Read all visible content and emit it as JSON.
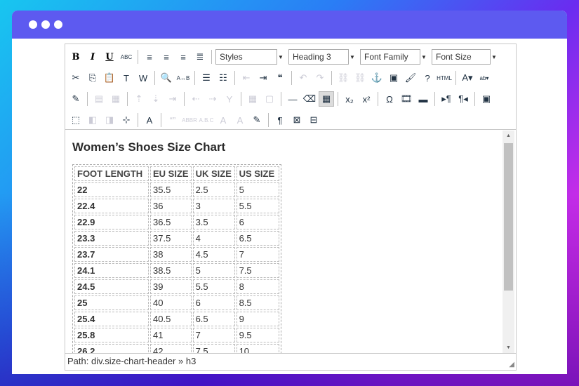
{
  "toolbar": {
    "rows": [
      [
        {
          "name": "bold",
          "glyph": "B"
        },
        {
          "name": "italic",
          "glyph": "I"
        },
        {
          "name": "underline",
          "glyph": "U"
        },
        {
          "name": "strikethrough",
          "glyph": "ABC"
        },
        {
          "sep": true
        },
        {
          "name": "align-left",
          "glyph": "≡"
        },
        {
          "name": "align-center",
          "glyph": "≡"
        },
        {
          "name": "align-right",
          "glyph": "≡"
        },
        {
          "name": "align-justify",
          "glyph": "≣"
        },
        {
          "sep": true
        },
        {
          "select": "styles",
          "label": "Styles",
          "w": 88
        },
        {
          "select": "format",
          "label": "Heading 3",
          "w": 86
        },
        {
          "select": "font-family",
          "label": "Font Family",
          "w": 86
        },
        {
          "select": "font-size",
          "label": "Font Size",
          "w": 84
        }
      ],
      [
        {
          "name": "cut",
          "glyph": "✂"
        },
        {
          "name": "copy",
          "glyph": "⎘"
        },
        {
          "name": "paste",
          "glyph": "📋"
        },
        {
          "name": "paste-text",
          "glyph": "T"
        },
        {
          "name": "paste-word",
          "glyph": "W"
        },
        {
          "sep": true
        },
        {
          "name": "find",
          "glyph": "🔍"
        },
        {
          "name": "replace",
          "glyph": "A↔B"
        },
        {
          "sep": true
        },
        {
          "name": "bullet-list",
          "glyph": "☰"
        },
        {
          "name": "numbered-list",
          "glyph": "☷"
        },
        {
          "sep": true
        },
        {
          "name": "outdent",
          "glyph": "⇤",
          "dis": true
        },
        {
          "name": "indent",
          "glyph": "⇥"
        },
        {
          "name": "blockquote",
          "glyph": "❝"
        },
        {
          "sep": true
        },
        {
          "name": "undo",
          "glyph": "↶",
          "dis": true
        },
        {
          "name": "redo",
          "glyph": "↷",
          "dis": true
        },
        {
          "sep": true
        },
        {
          "name": "link",
          "glyph": "⛓",
          "dis": true
        },
        {
          "name": "unlink",
          "glyph": "⛓",
          "dis": true
        },
        {
          "name": "anchor",
          "glyph": "⚓"
        },
        {
          "name": "image",
          "glyph": "▣"
        },
        {
          "name": "cleanup",
          "glyph": "🖌"
        },
        {
          "name": "help",
          "glyph": "?"
        },
        {
          "name": "html",
          "glyph": "HTML"
        },
        {
          "sep": true
        },
        {
          "name": "text-color",
          "glyph": "A▾"
        },
        {
          "name": "highlight-color",
          "glyph": "ab▾"
        }
      ],
      [
        {
          "name": "table-props",
          "glyph": "✎"
        },
        {
          "sep": true
        },
        {
          "name": "row-props",
          "glyph": "▤",
          "dis": true
        },
        {
          "name": "cell-props",
          "glyph": "▦",
          "dis": true
        },
        {
          "sep": true
        },
        {
          "name": "row-before",
          "glyph": "⇡",
          "dis": true
        },
        {
          "name": "row-after",
          "glyph": "⇣",
          "dis": true
        },
        {
          "name": "delete-row",
          "glyph": "⇥",
          "dis": true
        },
        {
          "sep": true
        },
        {
          "name": "col-before",
          "glyph": "⇠",
          "dis": true
        },
        {
          "name": "col-after",
          "glyph": "⇢",
          "dis": true
        },
        {
          "name": "delete-col",
          "glyph": "Y",
          "dis": true
        },
        {
          "sep": true
        },
        {
          "name": "split-cells",
          "glyph": "▦",
          "dis": true
        },
        {
          "name": "merge-cells",
          "glyph": "▢",
          "dis": true
        },
        {
          "sep": true
        },
        {
          "name": "horizontal-rule",
          "glyph": "—"
        },
        {
          "name": "remove-format",
          "glyph": "⌫"
        },
        {
          "name": "visual-aid",
          "glyph": "▦",
          "active": true
        },
        {
          "sep": true
        },
        {
          "name": "subscript",
          "glyph": "x₂"
        },
        {
          "name": "superscript",
          "glyph": "x²"
        },
        {
          "sep": true
        },
        {
          "name": "special-char",
          "glyph": "Ω"
        },
        {
          "name": "media",
          "glyph": "🎞"
        },
        {
          "name": "advanced-hr",
          "glyph": "▬"
        },
        {
          "sep": true
        },
        {
          "name": "ltr",
          "glyph": "▸¶"
        },
        {
          "name": "rtl",
          "glyph": "¶◂"
        },
        {
          "sep": true
        },
        {
          "name": "fullscreen",
          "glyph": "▣"
        }
      ],
      [
        {
          "name": "insert-layer",
          "glyph": "⬚"
        },
        {
          "name": "move-forward",
          "glyph": "◧",
          "dis": true
        },
        {
          "name": "move-backward",
          "glyph": "◨",
          "dis": true
        },
        {
          "name": "absolute",
          "glyph": "⊹"
        },
        {
          "sep": true
        },
        {
          "name": "styleprops",
          "glyph": "A"
        },
        {
          "sep": true
        },
        {
          "name": "cite",
          "glyph": "“”",
          "dis": true
        },
        {
          "name": "abbr",
          "glyph": "ABBR",
          "dis": true
        },
        {
          "name": "acronym",
          "glyph": "A.B.C",
          "dis": true
        },
        {
          "name": "del",
          "glyph": "A",
          "dis": true
        },
        {
          "name": "ins",
          "glyph": "A",
          "dis": true
        },
        {
          "name": "attributes",
          "glyph": "✎"
        },
        {
          "sep": true
        },
        {
          "name": "show-blocks",
          "glyph": "¶"
        },
        {
          "name": "nonbreaking",
          "glyph": "⊠"
        },
        {
          "name": "pagebreak",
          "glyph": "⊟"
        }
      ]
    ]
  },
  "content": {
    "heading": "Women’s Shoes Size Chart",
    "table": {
      "headers": [
        "FOOT LENGTH",
        "EU SIZE",
        "UK SIZE",
        "US SIZE"
      ],
      "rows": [
        [
          "22",
          "35.5",
          "2.5",
          "5"
        ],
        [
          "22.4",
          "36",
          "3",
          "5.5"
        ],
        [
          "22.9",
          "36.5",
          "3.5",
          "6"
        ],
        [
          "23.3",
          "37.5",
          "4",
          "6.5"
        ],
        [
          "23.7",
          "38",
          "4.5",
          "7"
        ],
        [
          "24.1",
          "38.5",
          "5",
          "7.5"
        ],
        [
          "24.5",
          "39",
          "5.5",
          "8"
        ],
        [
          "25",
          "40",
          "6",
          "8.5"
        ],
        [
          "25.4",
          "40.5",
          "6.5",
          "9"
        ],
        [
          "25.8",
          "41",
          "7",
          "9.5"
        ],
        [
          "26.2",
          "42",
          "7.5",
          "10"
        ]
      ]
    }
  },
  "status": {
    "path": "Path: div.size-chart-header » h3"
  },
  "colors": {
    "titlebar": "#5d5af0"
  }
}
